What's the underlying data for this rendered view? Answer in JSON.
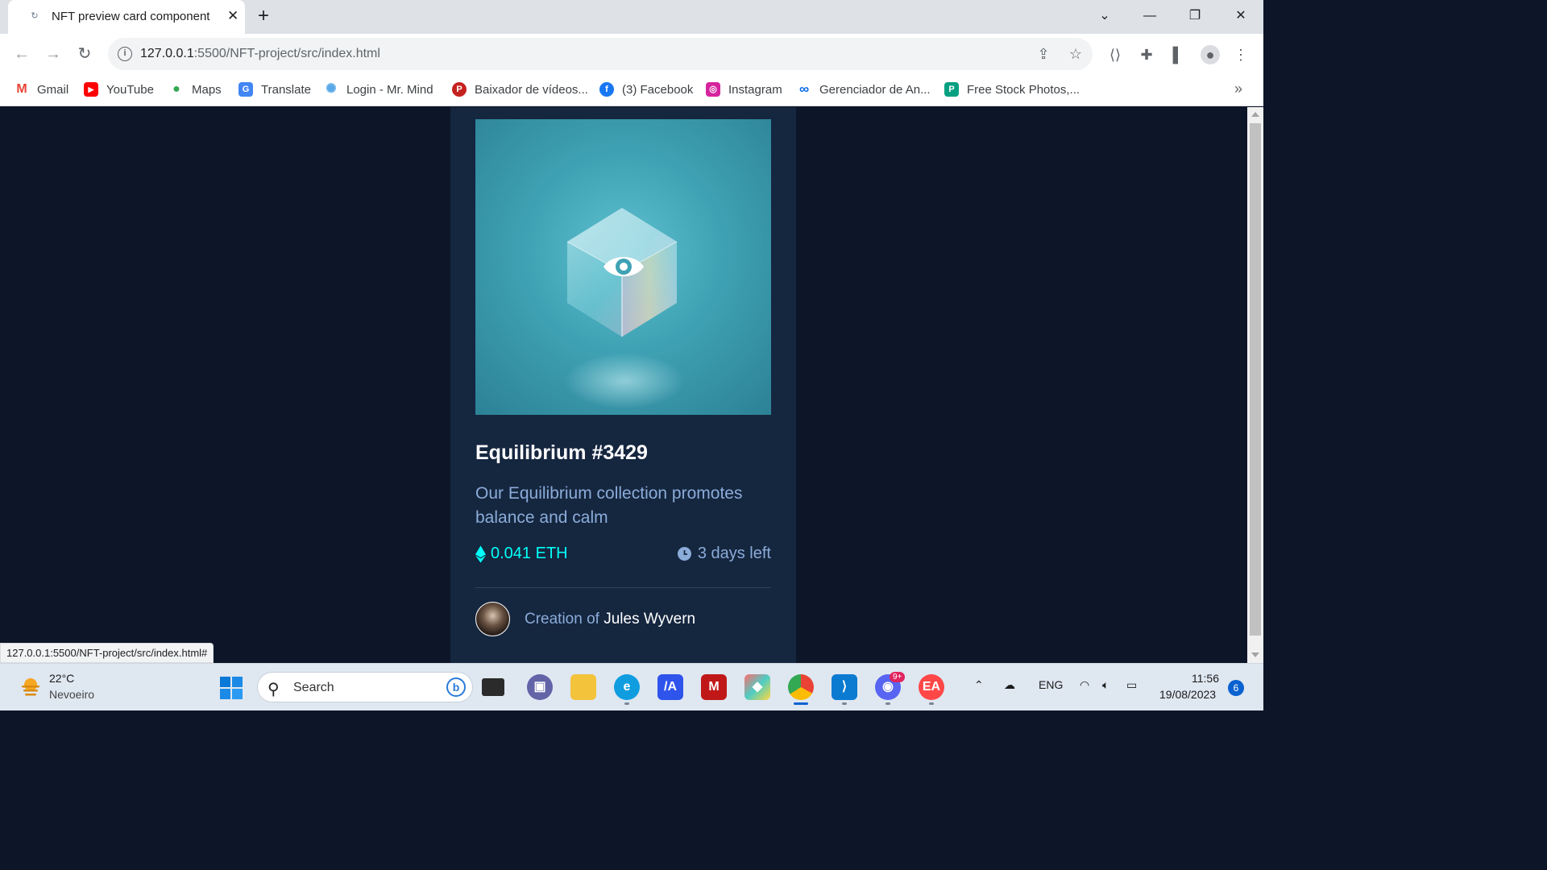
{
  "browser": {
    "tab_title": "NFT preview card component",
    "tab_close": "✕",
    "new_tab": "+",
    "url_host": "127.0.0.1",
    "url_path": ":5500/NFT-project/src/index.html",
    "status_url": "127.0.0.1:5500/NFT-project/src/index.html#",
    "bookmarks": [
      {
        "label": "Gmail",
        "icon": "gmail-icon",
        "color": "#ea4335",
        "glyph": "M"
      },
      {
        "label": "YouTube",
        "icon": "youtube-icon",
        "color": "#ff0000",
        "glyph": "▶"
      },
      {
        "label": "Maps",
        "icon": "maps-icon",
        "color": "#34a853",
        "glyph": "●"
      },
      {
        "label": "Translate",
        "icon": "translate-icon",
        "color": "#4285f4",
        "glyph": "G"
      },
      {
        "label": "Login - Mr. Mind",
        "icon": "gear-icon",
        "color": "#5aa9e6",
        "glyph": "✺"
      },
      {
        "label": "Baixador de vídeos...",
        "icon": "p-logo-icon",
        "color": "#c5221f",
        "glyph": "P"
      },
      {
        "label": "(3) Facebook",
        "icon": "facebook-icon",
        "color": "#1877f2",
        "glyph": "f"
      },
      {
        "label": "Instagram",
        "icon": "instagram-icon",
        "color": "#d6249f",
        "glyph": "◎"
      },
      {
        "label": "Gerenciador de An...",
        "icon": "meta-icon",
        "color": "#0668e1",
        "glyph": "∞"
      },
      {
        "label": "Free Stock Photos,...",
        "icon": "pexels-icon",
        "color": "#05a081",
        "glyph": "P"
      }
    ],
    "bookmarks_more": "»"
  },
  "card": {
    "title": "Equilibrium #3429",
    "description": "Our Equilibrium collection promotes balance and calm",
    "price": "0.041 ETH",
    "time_left": "3 days left",
    "creator_prefix": "Creation of",
    "creator_name": "Jules Wyvern",
    "colors": {
      "bg": "#15263f",
      "accent": "#00fff8",
      "soft_blue": "#8bacd9",
      "page_bg": "#0d1628"
    }
  },
  "taskbar": {
    "weather_temp": "22°C",
    "weather_desc": "Nevoeiro",
    "search_placeholder": "Search",
    "tray_lang": "ENG",
    "clock_time": "11:56",
    "clock_date": "19/08/2023",
    "notification_count": "6",
    "discord_badge": "9+",
    "apps": [
      {
        "name": "file-explorer-dark-icon"
      },
      {
        "name": "teams-chat-icon"
      },
      {
        "name": "file-explorer-icon"
      },
      {
        "name": "edge-icon"
      },
      {
        "name": "app-ai-icon"
      },
      {
        "name": "mcafee-icon"
      },
      {
        "name": "git-icon"
      },
      {
        "name": "chrome-icon"
      },
      {
        "name": "vscode-icon"
      },
      {
        "name": "discord-icon"
      },
      {
        "name": "ea-icon"
      }
    ]
  }
}
